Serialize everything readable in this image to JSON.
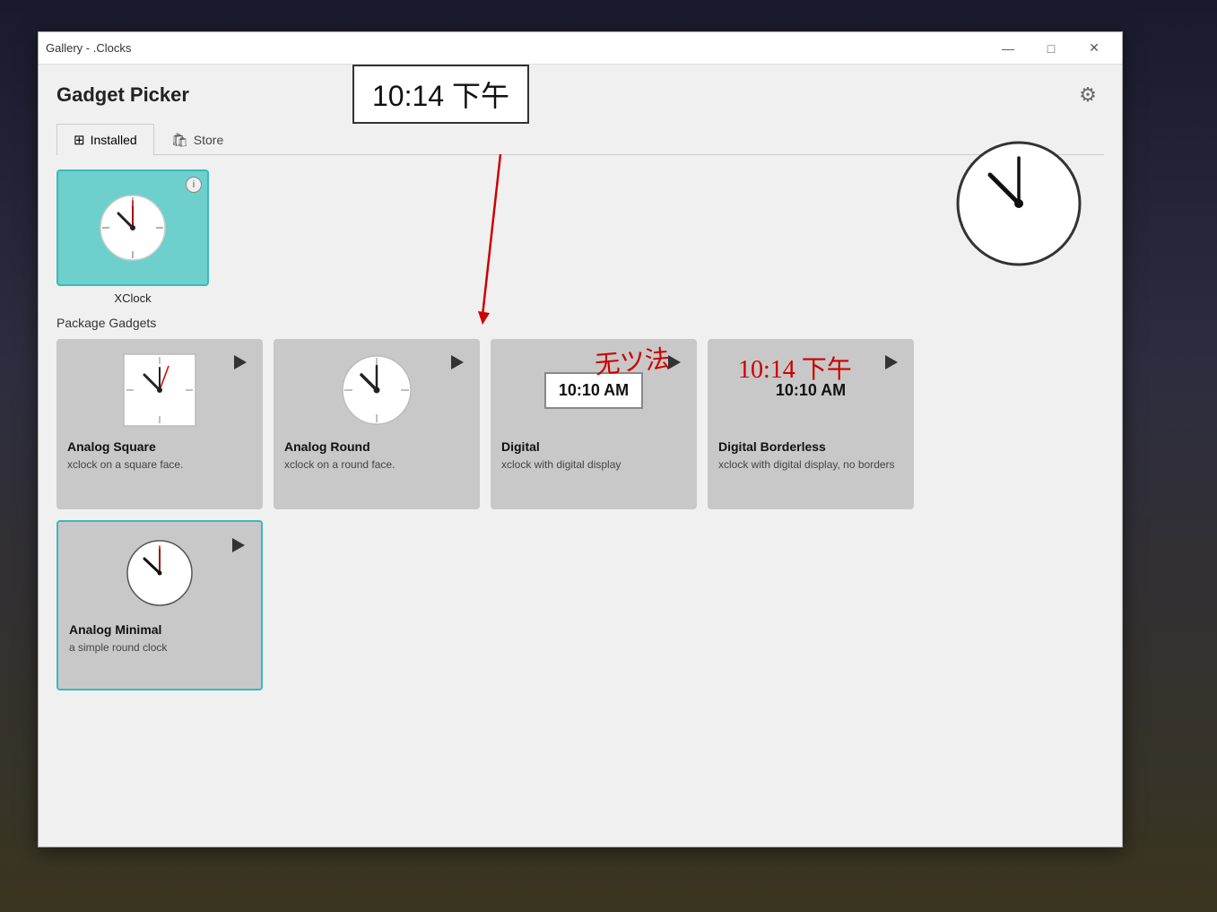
{
  "window": {
    "title": "Gallery - .Clocks",
    "minimize_label": "—",
    "maximize_label": "□",
    "close_label": "✕"
  },
  "header": {
    "title": "Gadget Picker",
    "gear_icon": "⚙"
  },
  "tabs": [
    {
      "id": "installed",
      "label": "Installed",
      "icon": "🏠",
      "active": true
    },
    {
      "id": "store",
      "label": "Store",
      "icon": "🛍",
      "active": false
    }
  ],
  "selected_gadget": {
    "name": "XClock",
    "info_icon": "i"
  },
  "section_label": "Package Gadgets",
  "gadgets": [
    {
      "id": "analog-square",
      "name": "Analog Square",
      "desc": "xclock on a square face.",
      "type": "analog-square"
    },
    {
      "id": "analog-round",
      "name": "Analog Round",
      "desc": "xclock on a round face.",
      "type": "analog-round"
    },
    {
      "id": "digital",
      "name": "Digital",
      "desc": "xclock with digital display",
      "type": "digital",
      "time_display": "10:10 AM"
    },
    {
      "id": "digital-borderless",
      "name": "Digital Borderless",
      "desc": "xclock with digital display, no borders",
      "type": "digital-borderless",
      "time_display": "10:10 AM"
    }
  ],
  "gadget_minimal": {
    "id": "analog-minimal",
    "name": "Analog Minimal",
    "desc": "a simple round clock",
    "type": "analog-minimal",
    "selected": true
  },
  "annotation": {
    "time_box": "10:14 下午",
    "handwritten": "无ツ法",
    "time_text": "10:14 下午"
  }
}
